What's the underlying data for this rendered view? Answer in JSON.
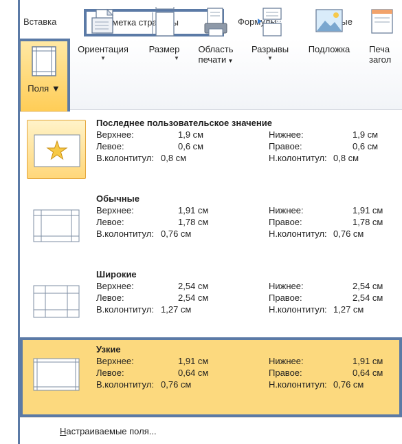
{
  "tabs": {
    "insert": "Вставка",
    "page_layout": "Разметка страницы",
    "formulas": "Формулы",
    "data": "Данные"
  },
  "ribbon": {
    "margins": "Поля",
    "orientation": "Ориентация",
    "size": "Размер",
    "print_area_1": "Область",
    "print_area_2": "печати",
    "breaks": "Разрывы",
    "background": "Подложка",
    "print_titles_1": "Печа",
    "print_titles_2": "загол"
  },
  "presets": [
    {
      "title": "Последнее пользовательское значение",
      "top_label": "Верхнее:",
      "top": "1,9 см",
      "bottom_label": "Нижнее:",
      "bottom": "1,9 см",
      "left_label": "Левое:",
      "left": "0,6 см",
      "right_label": "Правое:",
      "right": "0,6 см",
      "header_label": "В.колонтитул:",
      "header": "0,8 см",
      "footer_label": "Н.колонтитул:",
      "footer": "0,8 см",
      "icon": "star-icon"
    },
    {
      "title": "Обычные",
      "top_label": "Верхнее:",
      "top": "1,91 см",
      "bottom_label": "Нижнее:",
      "bottom": "1,91 см",
      "left_label": "Левое:",
      "left": "1,78 см",
      "right_label": "Правое:",
      "right": "1,78 см",
      "header_label": "В.колонтитул:",
      "header": "0,76 см",
      "footer_label": "Н.колонтитул:",
      "footer": "0,76 см",
      "icon": "page-margins-icon"
    },
    {
      "title": "Широкие",
      "top_label": "Верхнее:",
      "top": "2,54 см",
      "bottom_label": "Нижнее:",
      "bottom": "2,54 см",
      "left_label": "Левое:",
      "left": "2,54 см",
      "right_label": "Правое:",
      "right": "2,54 см",
      "header_label": "В.колонтитул:",
      "header": "1,27 см",
      "footer_label": "Н.колонтитул:",
      "footer": "1,27 см",
      "icon": "page-margins-icon"
    },
    {
      "title": "Узкие",
      "top_label": "Верхнее:",
      "top": "1,91 см",
      "bottom_label": "Нижнее:",
      "bottom": "1,91 см",
      "left_label": "Левое:",
      "left": "0,64 см",
      "right_label": "Правое:",
      "right": "0,64 см",
      "header_label": "В.колонтитул:",
      "header": "0,76 см",
      "footer_label": "Н.колонтитул:",
      "footer": "0,76 см",
      "icon": "page-margins-icon"
    }
  ],
  "custom": {
    "hotkey": "Н",
    "rest": "астраиваемые поля..."
  },
  "colors": {
    "highlight": "#fcd97e",
    "selection_outline": "#5b7aa6",
    "button_hover": "#ffcd57"
  }
}
